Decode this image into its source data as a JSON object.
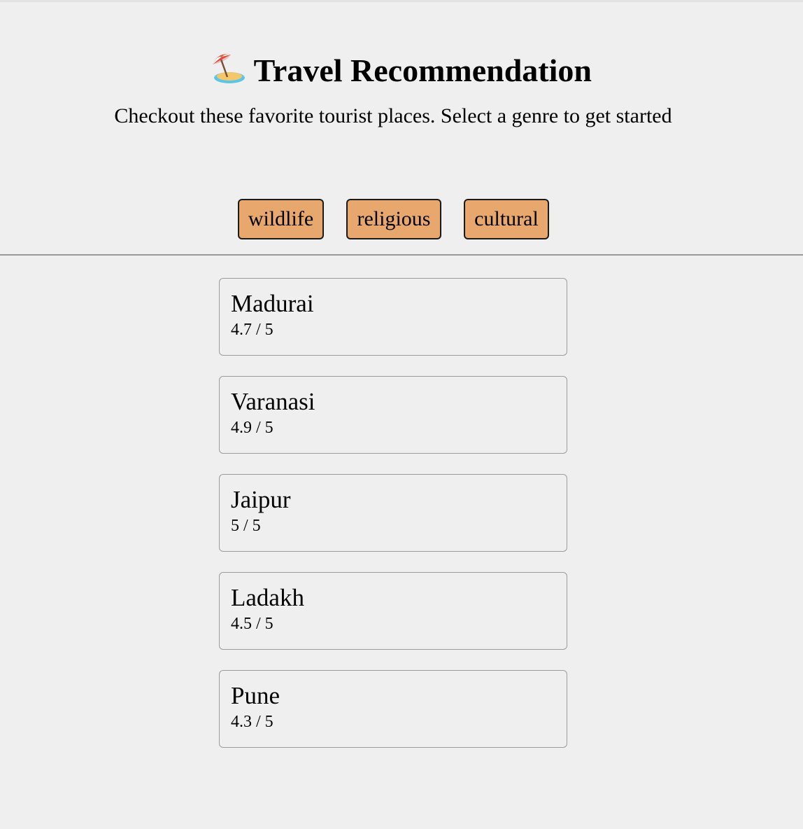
{
  "header": {
    "title": "Travel Recommendation",
    "subtitle": "Checkout these favorite tourist places. Select a genre to get started",
    "title_icon": "beach-umbrella-island-icon"
  },
  "genres": [
    {
      "label": "wildlife"
    },
    {
      "label": "religious"
    },
    {
      "label": "cultural"
    }
  ],
  "places": [
    {
      "name": "Madurai",
      "rating": "4.7 / 5"
    },
    {
      "name": "Varanasi",
      "rating": "4.9 / 5"
    },
    {
      "name": "Jaipur",
      "rating": "5 / 5"
    },
    {
      "name": "Ladakh",
      "rating": "4.5 / 5"
    },
    {
      "name": "Pune",
      "rating": "4.3 / 5"
    }
  ],
  "colors": {
    "background": "#efefef",
    "genre_button": "#e8a76d",
    "divider": "#9a9a9a",
    "card_border": "#9c9c9c"
  }
}
